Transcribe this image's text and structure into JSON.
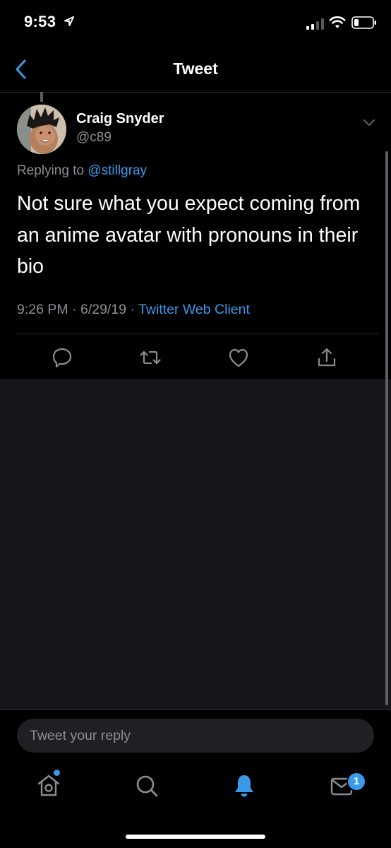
{
  "status_bar": {
    "time": "9:53"
  },
  "nav": {
    "title": "Tweet"
  },
  "tweet": {
    "author_name": "Craig Snyder",
    "author_handle": "@c89",
    "replying_prefix": "Replying to",
    "replying_to": "@stillgray",
    "text": "Not sure what you expect coming from an anime avatar with pronouns in their bio",
    "time": "9:26 PM",
    "date": "6/29/19",
    "separator": "·",
    "client": "Twitter Web Client"
  },
  "composer": {
    "placeholder": "Tweet your reply"
  },
  "tab_bar": {
    "messages_badge": "1"
  },
  "colors": {
    "accent": "#3a9ae9",
    "background": "#000000",
    "muted": "#8a8d91",
    "panel": "#16171b"
  }
}
